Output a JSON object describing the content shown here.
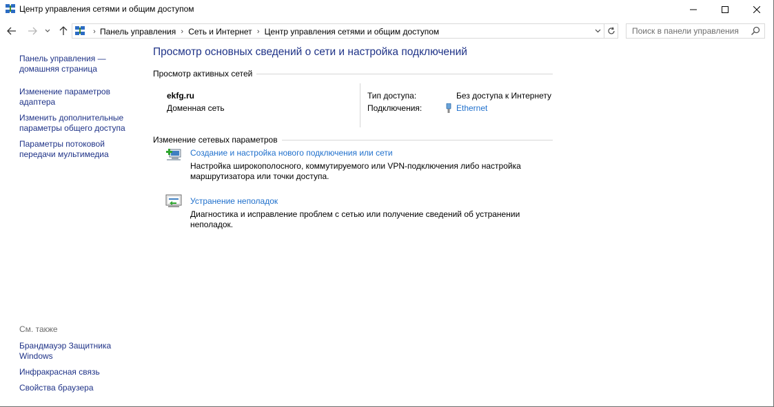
{
  "window": {
    "title": "Центр управления сетями и общим доступом"
  },
  "address": {
    "crumbs": [
      "Панель управления",
      "Сеть и Интернет",
      "Центр управления сетями и общим доступом"
    ]
  },
  "search": {
    "placeholder": "Поиск в панели управления"
  },
  "sidebar": {
    "home_label_line1": "Панель управления —",
    "home_label_line2": "домашняя страница",
    "items": [
      {
        "line1": "Изменение параметров",
        "line2": "адаптера"
      },
      {
        "line1": "Изменить дополнительные",
        "line2": "параметры общего доступа"
      },
      {
        "line1": "Параметры потоковой",
        "line2": "передачи мультимедиа"
      }
    ],
    "see_also_title": "См. также",
    "see_also": [
      {
        "line1": "Брандмауэр Защитника",
        "line2": "Windows"
      },
      {
        "line1": "Инфракрасная связь",
        "line2": ""
      },
      {
        "line1": "Свойства браузера",
        "line2": ""
      }
    ]
  },
  "main": {
    "page_title": "Просмотр основных сведений о сети и настройка подключений",
    "active_networks_header": "Просмотр активных сетей",
    "network": {
      "name": "ekfg.ru",
      "type": "Доменная сеть",
      "access_label": "Тип доступа:",
      "access_value": "Без доступа к Интернету",
      "connections_label": "Подключения:",
      "connection_name": "Ethernet"
    },
    "change_settings_header": "Изменение сетевых параметров",
    "tasks": [
      {
        "icon": "new-connection-icon",
        "link": "Создание и настройка нового подключения или сети",
        "desc_line1": "Настройка широкополосного, коммутируемого или VPN-подключения либо настройка",
        "desc_line2": "маршрутизатора или точки доступа."
      },
      {
        "icon": "troubleshoot-icon",
        "link": "Устранение неполадок",
        "desc_line1": "Диагностика и исправление проблем с сетью или получение сведений об устранении",
        "desc_line2": "неполадок."
      }
    ]
  },
  "colors": {
    "link_dark": "#1e3287",
    "link": "#1e6fcc",
    "muted": "#6d6d6d"
  }
}
